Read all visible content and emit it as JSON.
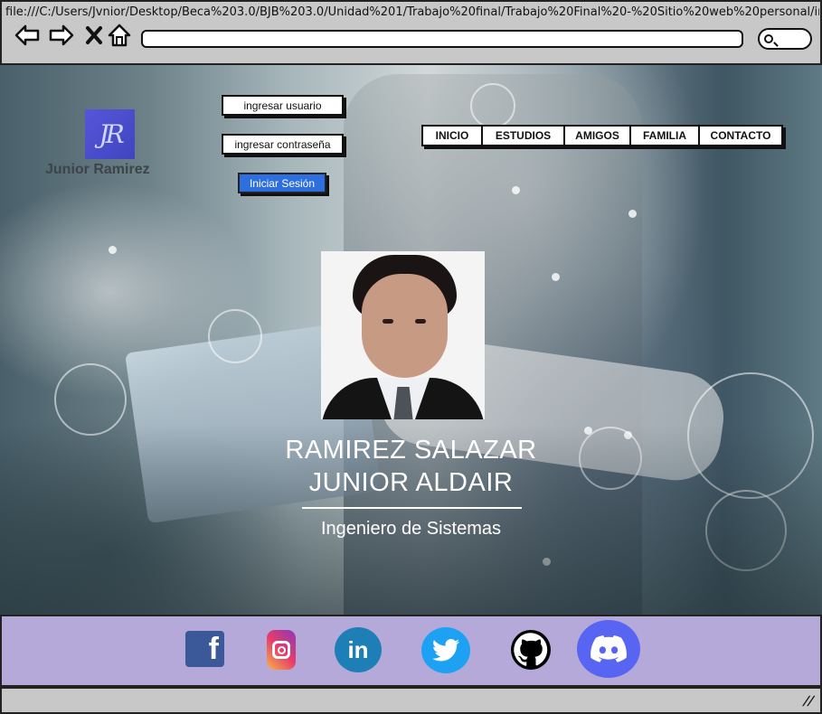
{
  "browser": {
    "url": "file:///C:/Users/Jvnior/Desktop/Beca%203.0/BJB%203.0/Unidad%201/Trabajo%20final/Trabajo%20Final%20-%20Sitio%20web%20personal/index.ht",
    "address_value": ""
  },
  "logo": {
    "monogram": "JR",
    "name": "Junior Ramirez"
  },
  "login": {
    "user_field": "ingresar usuario",
    "password_field": "ingresar contraseña",
    "submit": "Iniciar Sesión"
  },
  "nav": {
    "items": [
      {
        "label": "INICIO"
      },
      {
        "label": "ESTUDIOS"
      },
      {
        "label": "AMIGOS"
      },
      {
        "label": "FAMILIA"
      },
      {
        "label": "CONTACTO"
      }
    ]
  },
  "profile": {
    "name_line1": "RAMIREZ SALAZAR",
    "name_line2": "JUNIOR ALDAIR",
    "role": "Ingeniero de Sistemas"
  },
  "social": {
    "icons": [
      "facebook-icon",
      "instagram-icon",
      "linkedin-icon",
      "twitter-icon",
      "github-icon",
      "discord-icon"
    ],
    "colors": {
      "facebook": "#3b5998",
      "linkedin": "#1e7fb6",
      "twitter": "#1da1f2",
      "discord": "#5865f2",
      "footer_bg": "#b4a9d9"
    }
  }
}
